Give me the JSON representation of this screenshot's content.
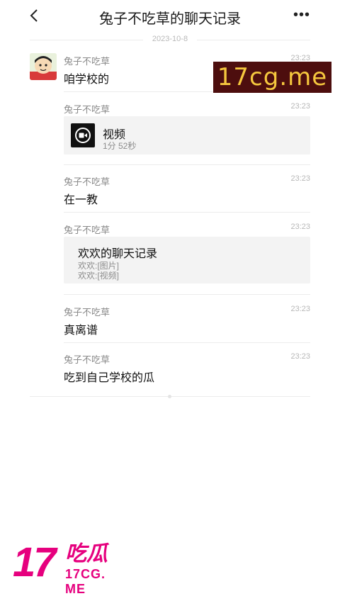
{
  "header": {
    "title": "兔子不吃草的聊天记录",
    "more": "•••"
  },
  "date_divider": "2023-10-8",
  "messages": [
    {
      "sender": "兔子不吃草",
      "time": "23:23",
      "text": "咱学校的"
    },
    {
      "sender": "兔子不吃草",
      "time": "23:23",
      "video": {
        "title": "视频",
        "duration": "1分 52秒"
      }
    },
    {
      "sender": "兔子不吃草",
      "time": "23:23",
      "text": "在一教"
    },
    {
      "sender": "兔子不吃草",
      "time": "23:23",
      "record": {
        "title": "欢欢的聊天记录",
        "lines": [
          "欢欢:[图片]",
          "欢欢:[视频]"
        ]
      }
    },
    {
      "sender": "兔子不吃草",
      "time": "23:23",
      "text": "真离谱"
    },
    {
      "sender": "兔子不吃草",
      "time": "23:23",
      "text": "吃到自己学校的瓜"
    }
  ],
  "watermark": {
    "text": "17cg.me",
    "bg_color": "#4d0e0e",
    "text_color": "#f6c83e"
  },
  "logo": {
    "num": "17",
    "cn": "吃瓜",
    "en": "17CG. ME",
    "color": "#e6007e"
  }
}
